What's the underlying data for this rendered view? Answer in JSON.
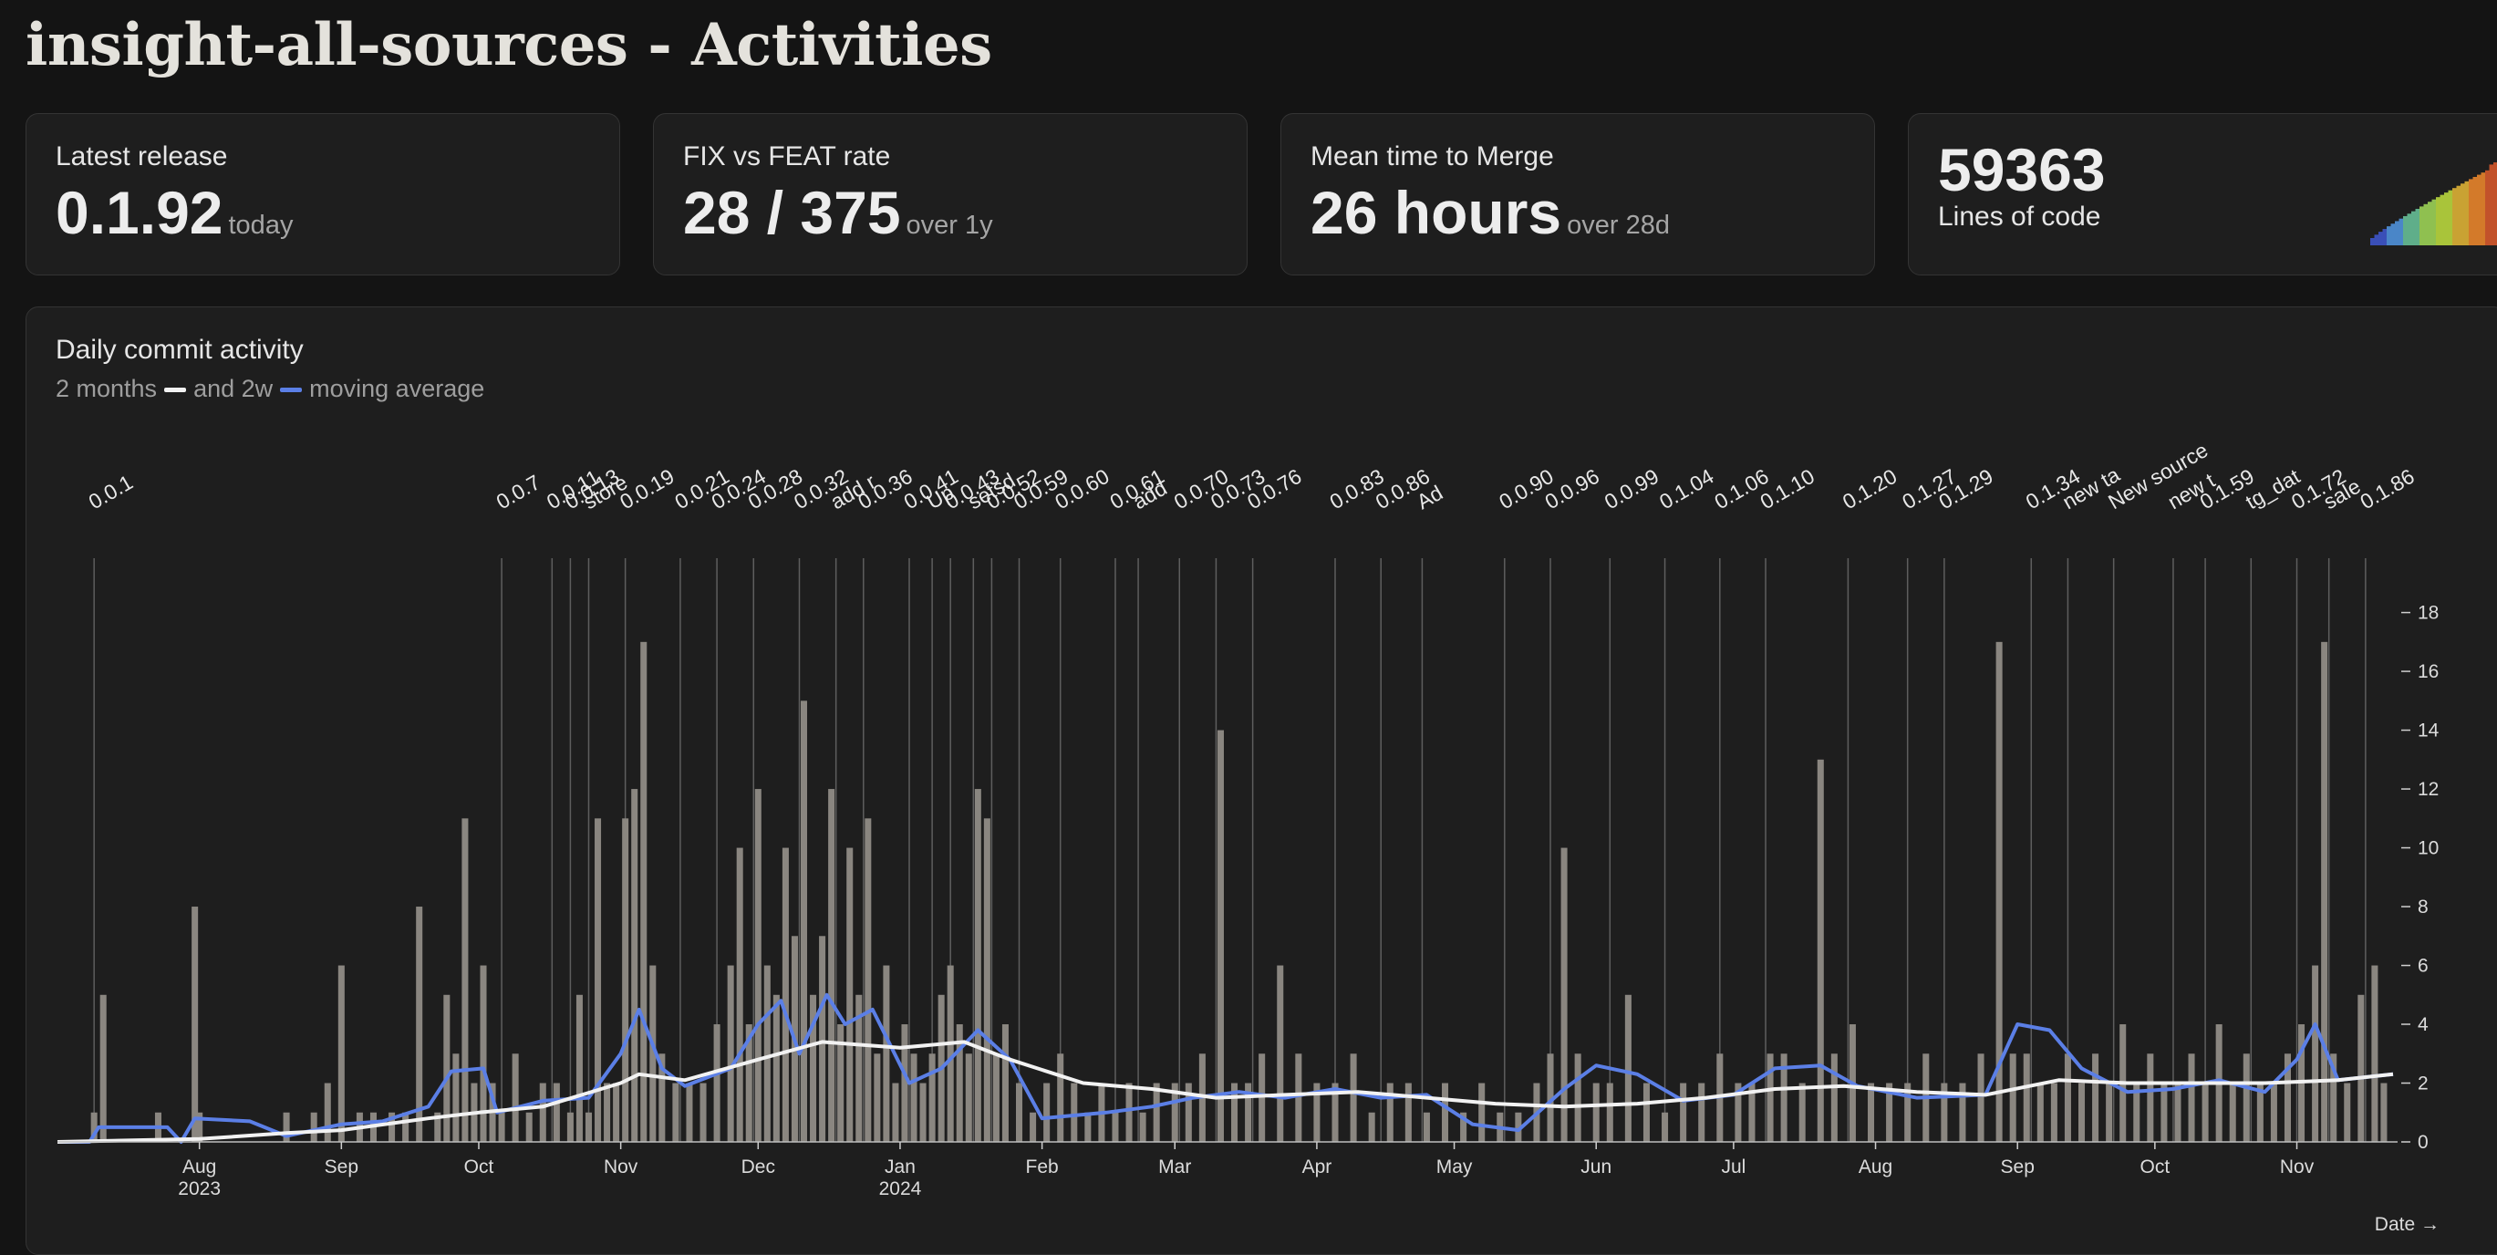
{
  "page": {
    "title": "insight-all-sources - Activities"
  },
  "cards": {
    "latest_release": {
      "label": "Latest release",
      "value": "0.1.92",
      "unit": "today"
    },
    "fix_feat": {
      "label": "FIX vs FEAT rate",
      "value": "28 / 375",
      "unit": "over 1y"
    },
    "merge_time": {
      "label": "Mean time to Merge",
      "value": "26 hours",
      "unit": "over 28d"
    },
    "loc": {
      "value": "59363",
      "label": "Lines of code"
    }
  },
  "colors": {
    "bars": "#8a8680",
    "release_lines": "#6e6e6e",
    "avg_2m": "#f2f2f2",
    "avg_2w": "#5b7fe6",
    "spark": [
      "#3a4fb8",
      "#4a86c8",
      "#5fae8a",
      "#8fc050",
      "#a9c43a",
      "#c9a233",
      "#d37a2a",
      "#c2522a",
      "#9e2f26",
      "#7a2222"
    ]
  },
  "chart_data": {
    "type": "bar",
    "title": "Daily commit activity",
    "subtitle": {
      "a": "2 months",
      "b": "and 2w",
      "c": "moving average"
    },
    "xlabel": "Date →",
    "ylim": [
      0,
      19.6
    ],
    "y_ticks": [
      0,
      2,
      4,
      6,
      8,
      10,
      12,
      14,
      16,
      18
    ],
    "x_range": [
      "2023-07-01",
      "2024-11-23"
    ],
    "x_ticks": [
      {
        "date": "2023-08-01",
        "label": "Aug",
        "year": "2023"
      },
      {
        "date": "2023-09-01",
        "label": "Sep",
        "year": ""
      },
      {
        "date": "2023-10-01",
        "label": "Oct",
        "year": ""
      },
      {
        "date": "2023-11-01",
        "label": "Nov",
        "year": ""
      },
      {
        "date": "2023-12-01",
        "label": "Dec",
        "year": ""
      },
      {
        "date": "2024-01-01",
        "label": "Jan",
        "year": "2024"
      },
      {
        "date": "2024-02-01",
        "label": "Feb",
        "year": ""
      },
      {
        "date": "2024-03-01",
        "label": "Mar",
        "year": ""
      },
      {
        "date": "2024-04-01",
        "label": "Apr",
        "year": ""
      },
      {
        "date": "2024-05-01",
        "label": "May",
        "year": ""
      },
      {
        "date": "2024-06-01",
        "label": "Jun",
        "year": ""
      },
      {
        "date": "2024-07-01",
        "label": "Jul",
        "year": ""
      },
      {
        "date": "2024-08-01",
        "label": "Aug",
        "year": ""
      },
      {
        "date": "2024-09-01",
        "label": "Sep",
        "year": ""
      },
      {
        "date": "2024-10-01",
        "label": "Oct",
        "year": ""
      },
      {
        "date": "2024-11-01",
        "label": "Nov",
        "year": ""
      }
    ],
    "bars": [
      [
        "2023-07-09",
        1
      ],
      [
        "2023-07-11",
        5
      ],
      [
        "2023-07-23",
        1
      ],
      [
        "2023-07-31",
        8
      ],
      [
        "2023-08-01",
        1
      ],
      [
        "2023-08-20",
        1
      ],
      [
        "2023-08-26",
        1
      ],
      [
        "2023-08-29",
        2
      ],
      [
        "2023-09-01",
        6
      ],
      [
        "2023-09-05",
        1
      ],
      [
        "2023-09-08",
        1
      ],
      [
        "2023-09-12",
        1
      ],
      [
        "2023-09-15",
        1
      ],
      [
        "2023-09-18",
        8
      ],
      [
        "2023-09-22",
        1
      ],
      [
        "2023-09-24",
        5
      ],
      [
        "2023-09-26",
        3
      ],
      [
        "2023-09-28",
        11
      ],
      [
        "2023-09-30",
        2
      ],
      [
        "2023-10-02",
        6
      ],
      [
        "2023-10-04",
        2
      ],
      [
        "2023-10-06",
        1
      ],
      [
        "2023-10-09",
        3
      ],
      [
        "2023-10-12",
        1
      ],
      [
        "2023-10-15",
        2
      ],
      [
        "2023-10-18",
        2
      ],
      [
        "2023-10-21",
        1
      ],
      [
        "2023-10-23",
        5
      ],
      [
        "2023-10-25",
        1
      ],
      [
        "2023-10-27",
        11
      ],
      [
        "2023-10-29",
        2
      ],
      [
        "2023-10-31",
        2
      ],
      [
        "2023-11-02",
        11
      ],
      [
        "2023-11-04",
        12
      ],
      [
        "2023-11-06",
        17
      ],
      [
        "2023-11-08",
        6
      ],
      [
        "2023-11-10",
        3
      ],
      [
        "2023-11-13",
        2
      ],
      [
        "2023-11-16",
        2
      ],
      [
        "2023-11-19",
        2
      ],
      [
        "2023-11-22",
        4
      ],
      [
        "2023-11-25",
        6
      ],
      [
        "2023-11-27",
        10
      ],
      [
        "2023-11-29",
        4
      ],
      [
        "2023-12-01",
        12
      ],
      [
        "2023-12-03",
        6
      ],
      [
        "2023-12-05",
        5
      ],
      [
        "2023-12-07",
        10
      ],
      [
        "2023-12-09",
        7
      ],
      [
        "2023-12-11",
        15
      ],
      [
        "2023-12-13",
        5
      ],
      [
        "2023-12-15",
        7
      ],
      [
        "2023-12-17",
        12
      ],
      [
        "2023-12-19",
        4
      ],
      [
        "2023-12-21",
        10
      ],
      [
        "2023-12-23",
        5
      ],
      [
        "2023-12-25",
        11
      ],
      [
        "2023-12-27",
        3
      ],
      [
        "2023-12-29",
        6
      ],
      [
        "2023-12-31",
        2
      ],
      [
        "2024-01-02",
        4
      ],
      [
        "2024-01-04",
        3
      ],
      [
        "2024-01-06",
        2
      ],
      [
        "2024-01-08",
        3
      ],
      [
        "2024-01-10",
        5
      ],
      [
        "2024-01-12",
        6
      ],
      [
        "2024-01-14",
        4
      ],
      [
        "2024-01-16",
        3
      ],
      [
        "2024-01-18",
        12
      ],
      [
        "2024-01-20",
        11
      ],
      [
        "2024-01-22",
        3
      ],
      [
        "2024-01-24",
        4
      ],
      [
        "2024-01-27",
        2
      ],
      [
        "2024-01-30",
        1
      ],
      [
        "2024-02-02",
        2
      ],
      [
        "2024-02-05",
        3
      ],
      [
        "2024-02-08",
        2
      ],
      [
        "2024-02-11",
        1
      ],
      [
        "2024-02-14",
        2
      ],
      [
        "2024-02-17",
        1
      ],
      [
        "2024-02-20",
        2
      ],
      [
        "2024-02-23",
        1
      ],
      [
        "2024-02-26",
        2
      ],
      [
        "2024-03-01",
        2
      ],
      [
        "2024-03-04",
        2
      ],
      [
        "2024-03-07",
        3
      ],
      [
        "2024-03-11",
        14
      ],
      [
        "2024-03-14",
        2
      ],
      [
        "2024-03-17",
        2
      ],
      [
        "2024-03-20",
        3
      ],
      [
        "2024-03-24",
        6
      ],
      [
        "2024-03-28",
        3
      ],
      [
        "2024-04-01",
        2
      ],
      [
        "2024-04-05",
        2
      ],
      [
        "2024-04-09",
        3
      ],
      [
        "2024-04-13",
        1
      ],
      [
        "2024-04-17",
        2
      ],
      [
        "2024-04-21",
        2
      ],
      [
        "2024-04-25",
        1
      ],
      [
        "2024-04-29",
        2
      ],
      [
        "2024-05-03",
        1
      ],
      [
        "2024-05-07",
        2
      ],
      [
        "2024-05-11",
        1
      ],
      [
        "2024-05-15",
        1
      ],
      [
        "2024-05-19",
        2
      ],
      [
        "2024-05-22",
        3
      ],
      [
        "2024-05-25",
        10
      ],
      [
        "2024-05-28",
        3
      ],
      [
        "2024-06-01",
        2
      ],
      [
        "2024-06-04",
        2
      ],
      [
        "2024-06-08",
        5
      ],
      [
        "2024-06-12",
        2
      ],
      [
        "2024-06-16",
        1
      ],
      [
        "2024-06-20",
        2
      ],
      [
        "2024-06-24",
        2
      ],
      [
        "2024-06-28",
        3
      ],
      [
        "2024-07-02",
        2
      ],
      [
        "2024-07-05",
        2
      ],
      [
        "2024-07-09",
        3
      ],
      [
        "2024-07-12",
        3
      ],
      [
        "2024-07-16",
        2
      ],
      [
        "2024-07-20",
        13
      ],
      [
        "2024-07-23",
        3
      ],
      [
        "2024-07-27",
        4
      ],
      [
        "2024-07-31",
        2
      ],
      [
        "2024-08-04",
        2
      ],
      [
        "2024-08-08",
        2
      ],
      [
        "2024-08-12",
        3
      ],
      [
        "2024-08-16",
        2
      ],
      [
        "2024-08-20",
        2
      ],
      [
        "2024-08-24",
        3
      ],
      [
        "2024-08-28",
        17
      ],
      [
        "2024-08-31",
        3
      ],
      [
        "2024-09-03",
        3
      ],
      [
        "2024-09-06",
        2
      ],
      [
        "2024-09-09",
        2
      ],
      [
        "2024-09-12",
        3
      ],
      [
        "2024-09-15",
        2
      ],
      [
        "2024-09-18",
        3
      ],
      [
        "2024-09-21",
        2
      ],
      [
        "2024-09-24",
        4
      ],
      [
        "2024-09-27",
        2
      ],
      [
        "2024-09-30",
        3
      ],
      [
        "2024-10-03",
        2
      ],
      [
        "2024-10-06",
        2
      ],
      [
        "2024-10-09",
        3
      ],
      [
        "2024-10-12",
        2
      ],
      [
        "2024-10-15",
        4
      ],
      [
        "2024-10-18",
        2
      ],
      [
        "2024-10-21",
        3
      ],
      [
        "2024-10-24",
        2
      ],
      [
        "2024-10-27",
        2
      ],
      [
        "2024-10-30",
        3
      ],
      [
        "2024-11-02",
        4
      ],
      [
        "2024-11-05",
        6
      ],
      [
        "2024-11-07",
        17
      ],
      [
        "2024-11-09",
        3
      ],
      [
        "2024-11-12",
        2
      ],
      [
        "2024-11-15",
        5
      ],
      [
        "2024-11-18",
        6
      ],
      [
        "2024-11-20",
        2
      ]
    ],
    "series": [
      {
        "name": "2 months",
        "points": [
          [
            "2023-07-01",
            0
          ],
          [
            "2023-08-01",
            0.1
          ],
          [
            "2023-08-20",
            0.3
          ],
          [
            "2023-09-01",
            0.4
          ],
          [
            "2023-09-20",
            0.8
          ],
          [
            "2023-10-01",
            1.0
          ],
          [
            "2023-10-15",
            1.2
          ],
          [
            "2023-11-01",
            2.0
          ],
          [
            "2023-11-05",
            2.3
          ],
          [
            "2023-11-15",
            2.1
          ],
          [
            "2023-12-01",
            2.8
          ],
          [
            "2023-12-15",
            3.4
          ],
          [
            "2024-01-01",
            3.2
          ],
          [
            "2024-01-15",
            3.4
          ],
          [
            "2024-01-25",
            2.8
          ],
          [
            "2024-02-10",
            2.0
          ],
          [
            "2024-02-25",
            1.8
          ],
          [
            "2024-03-10",
            1.5
          ],
          [
            "2024-03-25",
            1.6
          ],
          [
            "2024-04-10",
            1.7
          ],
          [
            "2024-04-25",
            1.5
          ],
          [
            "2024-05-10",
            1.3
          ],
          [
            "2024-05-25",
            1.2
          ],
          [
            "2024-06-10",
            1.3
          ],
          [
            "2024-06-25",
            1.5
          ],
          [
            "2024-07-10",
            1.8
          ],
          [
            "2024-07-25",
            1.9
          ],
          [
            "2024-08-10",
            1.7
          ],
          [
            "2024-08-25",
            1.6
          ],
          [
            "2024-09-10",
            2.1
          ],
          [
            "2024-09-25",
            2.0
          ],
          [
            "2024-10-10",
            2.0
          ],
          [
            "2024-10-25",
            2.0
          ],
          [
            "2024-11-10",
            2.1
          ],
          [
            "2024-11-22",
            2.3
          ]
        ]
      },
      {
        "name": "2w",
        "points": [
          [
            "2023-07-01",
            0
          ],
          [
            "2023-07-08",
            0
          ],
          [
            "2023-07-10",
            0.5
          ],
          [
            "2023-07-25",
            0.5
          ],
          [
            "2023-07-28",
            0
          ],
          [
            "2023-07-31",
            0.8
          ],
          [
            "2023-08-12",
            0.7
          ],
          [
            "2023-08-20",
            0.2
          ],
          [
            "2023-09-01",
            0.6
          ],
          [
            "2023-09-10",
            0.7
          ],
          [
            "2023-09-20",
            1.2
          ],
          [
            "2023-09-25",
            2.4
          ],
          [
            "2023-10-02",
            2.5
          ],
          [
            "2023-10-05",
            1.0
          ],
          [
            "2023-10-15",
            1.4
          ],
          [
            "2023-10-25",
            1.5
          ],
          [
            "2023-11-01",
            3.0
          ],
          [
            "2023-11-05",
            4.5
          ],
          [
            "2023-11-10",
            2.5
          ],
          [
            "2023-11-15",
            1.9
          ],
          [
            "2023-11-25",
            2.5
          ],
          [
            "2023-12-01",
            4.0
          ],
          [
            "2023-12-06",
            4.8
          ],
          [
            "2023-12-10",
            3.0
          ],
          [
            "2023-12-16",
            5.0
          ],
          [
            "2023-12-20",
            4.0
          ],
          [
            "2023-12-26",
            4.5
          ],
          [
            "2024-01-03",
            2.0
          ],
          [
            "2024-01-10",
            2.5
          ],
          [
            "2024-01-18",
            3.8
          ],
          [
            "2024-01-25",
            2.8
          ],
          [
            "2024-02-01",
            0.8
          ],
          [
            "2024-02-15",
            1.0
          ],
          [
            "2024-02-25",
            1.2
          ],
          [
            "2024-03-05",
            1.5
          ],
          [
            "2024-03-15",
            1.7
          ],
          [
            "2024-03-25",
            1.5
          ],
          [
            "2024-04-05",
            1.8
          ],
          [
            "2024-04-15",
            1.5
          ],
          [
            "2024-04-25",
            1.6
          ],
          [
            "2024-05-05",
            0.6
          ],
          [
            "2024-05-15",
            0.4
          ],
          [
            "2024-05-25",
            1.8
          ],
          [
            "2024-06-01",
            2.6
          ],
          [
            "2024-06-10",
            2.3
          ],
          [
            "2024-06-20",
            1.4
          ],
          [
            "2024-07-01",
            1.6
          ],
          [
            "2024-07-10",
            2.5
          ],
          [
            "2024-07-20",
            2.6
          ],
          [
            "2024-07-28",
            1.9
          ],
          [
            "2024-08-10",
            1.5
          ],
          [
            "2024-08-25",
            1.6
          ],
          [
            "2024-09-01",
            4.0
          ],
          [
            "2024-09-08",
            3.8
          ],
          [
            "2024-09-15",
            2.5
          ],
          [
            "2024-09-25",
            1.7
          ],
          [
            "2024-10-05",
            1.8
          ],
          [
            "2024-10-15",
            2.1
          ],
          [
            "2024-10-25",
            1.7
          ],
          [
            "2024-11-01",
            2.8
          ],
          [
            "2024-11-05",
            4.0
          ],
          [
            "2024-11-10",
            2.1
          ],
          [
            "2024-11-22",
            2.3
          ]
        ]
      }
    ],
    "releases": [
      [
        "2023-07-09",
        "0.0.1"
      ],
      [
        "2023-10-06",
        "0.0.7"
      ],
      [
        "2023-10-17",
        "0.0.11"
      ],
      [
        "2023-10-21",
        "0.0.13"
      ],
      [
        "2023-10-25",
        "store"
      ],
      [
        "2023-11-02",
        "0.0.19"
      ],
      [
        "2023-11-14",
        "0.0.21"
      ],
      [
        "2023-11-22",
        "0.0.24"
      ],
      [
        "2023-11-30",
        "0.0.28"
      ],
      [
        "2023-12-10",
        "0.0.32"
      ],
      [
        "2023-12-18",
        "add r"
      ],
      [
        "2023-12-24",
        "0.0.36"
      ],
      [
        "2024-01-03",
        "0.0.41"
      ],
      [
        "2024-01-08",
        "Up"
      ],
      [
        "2024-01-12",
        "0.0.43"
      ],
      [
        "2024-01-17",
        "setsd"
      ],
      [
        "2024-01-21",
        "0.0.52"
      ],
      [
        "2024-01-27",
        "0.0.59"
      ],
      [
        "2024-02-05",
        "0.0.60"
      ],
      [
        "2024-02-17",
        "0.0.61"
      ],
      [
        "2024-02-22",
        "add"
      ],
      [
        "2024-03-02",
        "0.0.70"
      ],
      [
        "2024-03-10",
        "0.0.73"
      ],
      [
        "2024-03-18",
        "0.0.76"
      ],
      [
        "2024-04-05",
        "0.0.83"
      ],
      [
        "2024-04-15",
        "0.0.86"
      ],
      [
        "2024-04-24",
        "Ad"
      ],
      [
        "2024-05-12",
        "0.0.90"
      ],
      [
        "2024-05-22",
        "0.0.96"
      ],
      [
        "2024-06-04",
        "0.0.99"
      ],
      [
        "2024-06-16",
        "0.1.04"
      ],
      [
        "2024-06-28",
        "0.1.06"
      ],
      [
        "2024-07-08",
        "0.1.10"
      ],
      [
        "2024-07-26",
        "0.1.20"
      ],
      [
        "2024-08-08",
        "0.1.27"
      ],
      [
        "2024-08-16",
        "0.1.29"
      ],
      [
        "2024-09-04",
        "0.1.34"
      ],
      [
        "2024-09-12",
        "new ta"
      ],
      [
        "2024-09-22",
        "New source"
      ],
      [
        "2024-10-05",
        "new t"
      ],
      [
        "2024-10-12",
        "0.1.59"
      ],
      [
        "2024-10-22",
        "tg_dat"
      ],
      [
        "2024-11-01",
        "0.1.72"
      ],
      [
        "2024-11-08",
        "sale"
      ],
      [
        "2024-11-16",
        "0.1.86"
      ]
    ]
  }
}
